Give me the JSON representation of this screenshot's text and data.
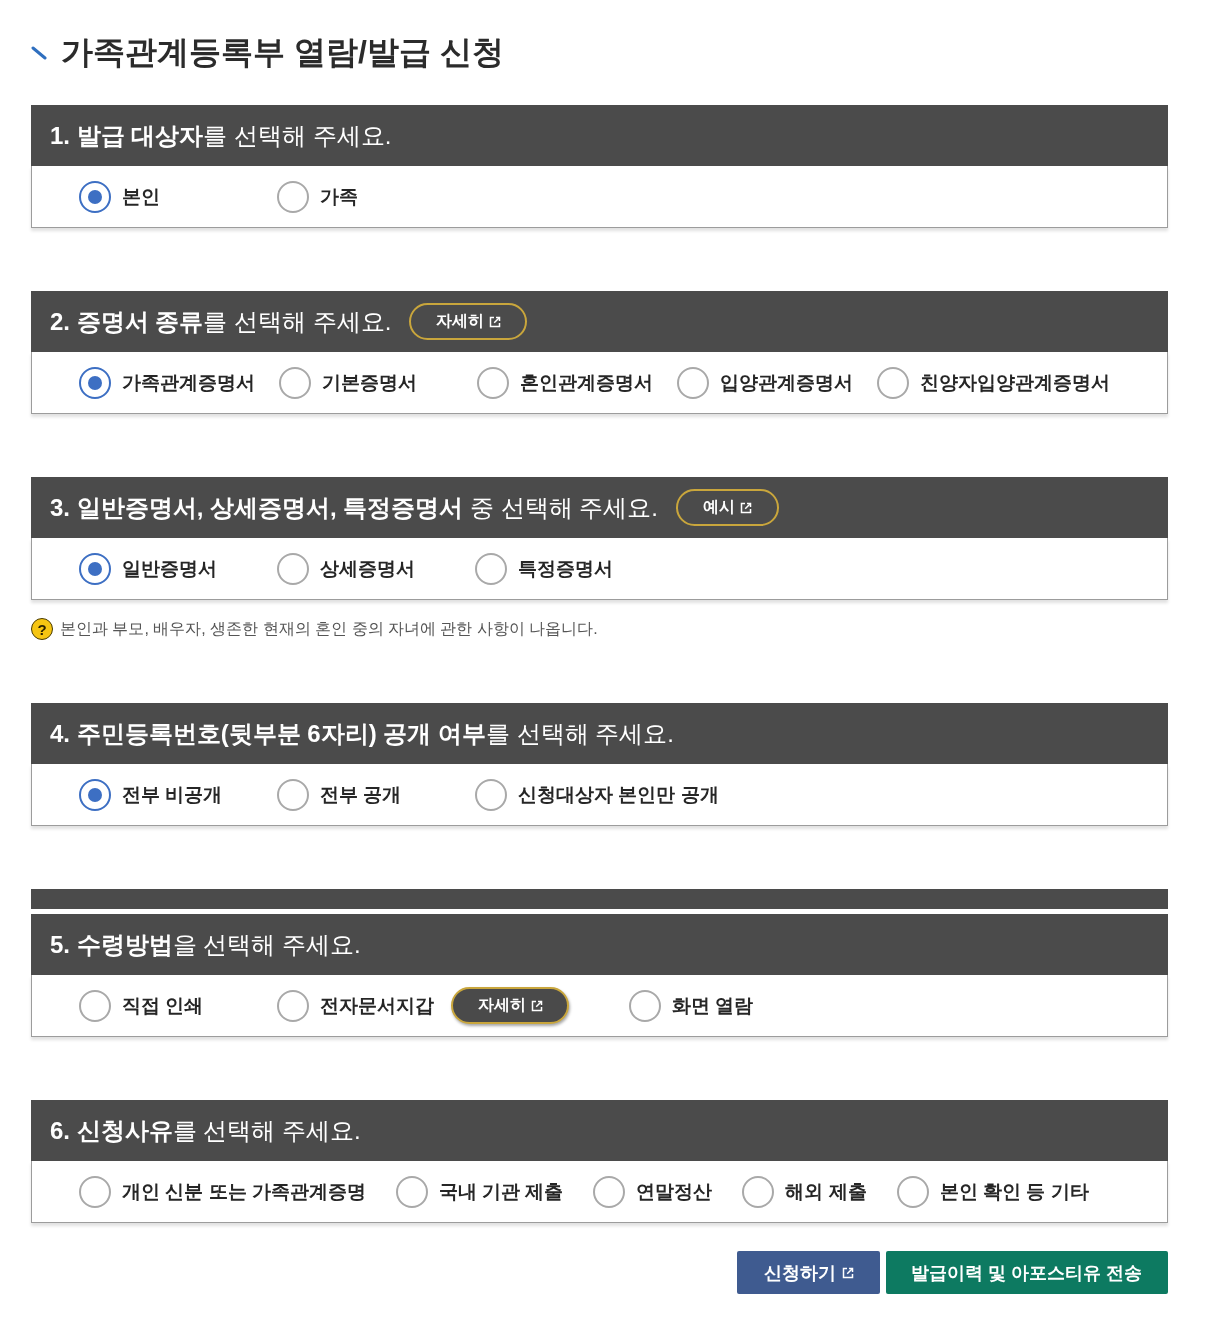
{
  "page": {
    "title": "가족관계등록부 열람/발급 신청"
  },
  "sections": [
    {
      "heading": "**1. 발급 대상자**를 선택해 주세요.",
      "options": [
        {
          "label": "본인",
          "selected": true
        },
        {
          "label": "가족",
          "selected": false
        }
      ]
    },
    {
      "heading": "**2. 증명서 종류**를 선택해 주세요.",
      "header_button": {
        "label": "자세히",
        "external": true
      },
      "options": [
        {
          "label": "가족관계증명서",
          "selected": true
        },
        {
          "label": "기본증명서",
          "selected": false
        },
        {
          "label": "혼인관계증명서",
          "selected": false
        },
        {
          "label": "입양관계증명서",
          "selected": false
        },
        {
          "label": "친양자입양관계증명서",
          "selected": false
        }
      ]
    },
    {
      "heading": "**3. 일반증명서, 상세증명서, 특정증명서** 중 선택해 주세요.",
      "header_button": {
        "label": "예시",
        "external": true
      },
      "options": [
        {
          "label": "일반증명서",
          "selected": true
        },
        {
          "label": "상세증명서",
          "selected": false
        },
        {
          "label": "특정증명서",
          "selected": false
        }
      ],
      "note": {
        "icon": "?",
        "text": "본인과 부모, 배우자, 생존한 현재의 혼인 중의 자녀에 관한 사항이 나옵니다."
      }
    },
    {
      "heading": "**4. 주민등록번호(뒷부분 6자리) 공개 여부**를 선택해 주세요.",
      "options": [
        {
          "label": "전부 비공개",
          "selected": true
        },
        {
          "label": "전부 공개",
          "selected": false
        },
        {
          "label": "신청대상자 본인만 공개",
          "selected": false
        }
      ]
    },
    {
      "heading": "**5. 수령방법**을 선택해 주세요.",
      "overlapped_strip": true,
      "options": [
        {
          "label": "직접 인쇄",
          "selected": false
        },
        {
          "label": "전자문서지갑",
          "selected": false,
          "detail_button": {
            "label": "자세히",
            "external": true
          }
        },
        {
          "label": "화면 열람",
          "selected": false
        }
      ]
    },
    {
      "heading": "**6. 신청사유**를 선택해 주세요.",
      "options": [
        {
          "label": "개인 신분 또는 가족관계증명",
          "selected": false
        },
        {
          "label": "국내 기관 제출",
          "selected": false
        },
        {
          "label": "연말정산",
          "selected": false
        },
        {
          "label": "해외 제출",
          "selected": false
        },
        {
          "label": "본인 확인 등 기타",
          "selected": false
        }
      ]
    }
  ],
  "actions": [
    {
      "label": "신청하기",
      "kind": "primary",
      "external": true
    },
    {
      "label": "발급이력 및 아포스티유 전송",
      "kind": "secondary",
      "external": false
    }
  ]
}
